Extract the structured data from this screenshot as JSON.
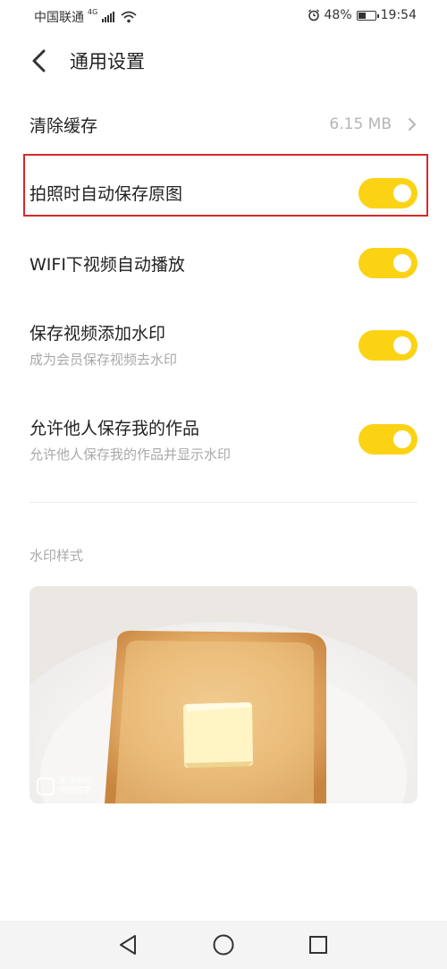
{
  "status_bar": {
    "carrier": "中国联通",
    "network": "4G",
    "battery_percent": "48%",
    "battery_level": 0.48,
    "time": "19:54"
  },
  "header": {
    "title": "通用设置",
    "back_icon": "chevron-left-icon"
  },
  "settings": {
    "clear_cache": {
      "label": "清除缓存",
      "value": "6.15 MB"
    },
    "auto_save_original": {
      "label": "拍照时自动保存原图",
      "enabled": true
    },
    "wifi_autoplay": {
      "label": "WIFI下视频自动播放",
      "enabled": true
    },
    "video_watermark": {
      "label": "保存视频添加水印",
      "subtitle": "成为会员保存视频去水印",
      "enabled": true
    },
    "allow_others_save": {
      "label": "允许他人保存我的作品",
      "subtitle": "允许他人保存我的作品并显示水印",
      "enabled": true
    }
  },
  "watermark_section": {
    "label": "水印样式",
    "preview_line1": "黄油相机",
    "preview_line2": "你的名字"
  },
  "nav_bar": {
    "back_icon": "triangle-back-icon",
    "home_icon": "circle-home-icon",
    "recents_icon": "square-recents-icon"
  },
  "colors": {
    "toggle_on": "#fbd314",
    "highlight": "#d32b2b"
  }
}
